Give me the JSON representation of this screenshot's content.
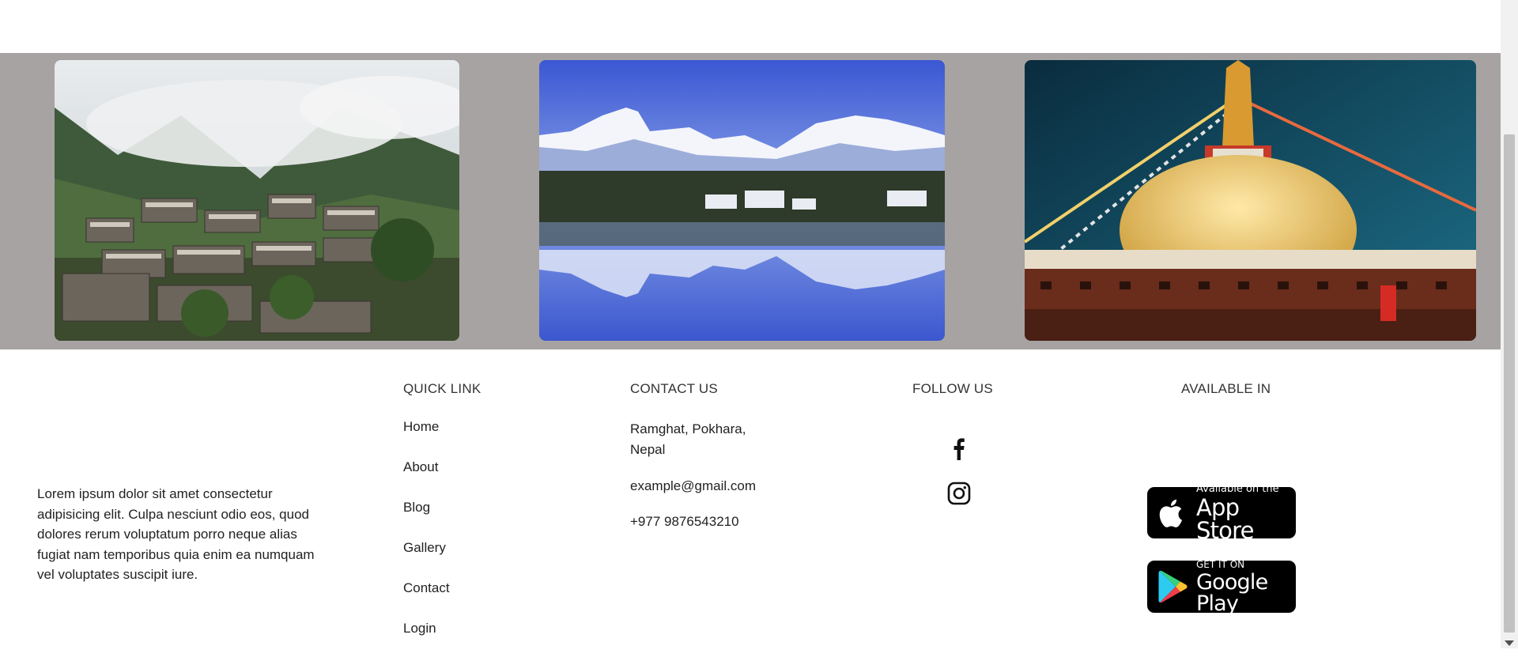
{
  "gallery": {
    "photos": [
      {
        "subject": "mountain-village-photo"
      },
      {
        "subject": "mountain-lake-reflection-photo"
      },
      {
        "subject": "stupa-temple-photo"
      }
    ]
  },
  "footer": {
    "about_text": "Lorem ipsum dolor sit amet consectetur adipisicing elit. Culpa nesciunt odio eos, quod dolores rerum voluptatum porro neque alias fugiat nam temporibus quia enim ea numquam vel voluptates suscipit iure.",
    "quick_link": {
      "heading": "QUICK LINK",
      "items": [
        "Home",
        "About",
        "Blog",
        "Gallery",
        "Contact",
        "Login"
      ]
    },
    "contact": {
      "heading": "CONTACT US",
      "address": "Ramghat, Pokhara, Nepal",
      "email": "example@gmail.com",
      "phone": "+977 9876543210"
    },
    "follow": {
      "heading": "FOLLOW US",
      "icons": [
        "facebook-icon",
        "instagram-icon"
      ]
    },
    "available": {
      "heading": "AVAILABLE IN",
      "app_store": {
        "small": "Available on the",
        "big": "App Store"
      },
      "google_play": {
        "small": "GET IT ON",
        "big": "Google Play"
      }
    }
  },
  "colors": {
    "gallery_bg": "#a7a3a3",
    "store_badge_bg": "#000000"
  }
}
